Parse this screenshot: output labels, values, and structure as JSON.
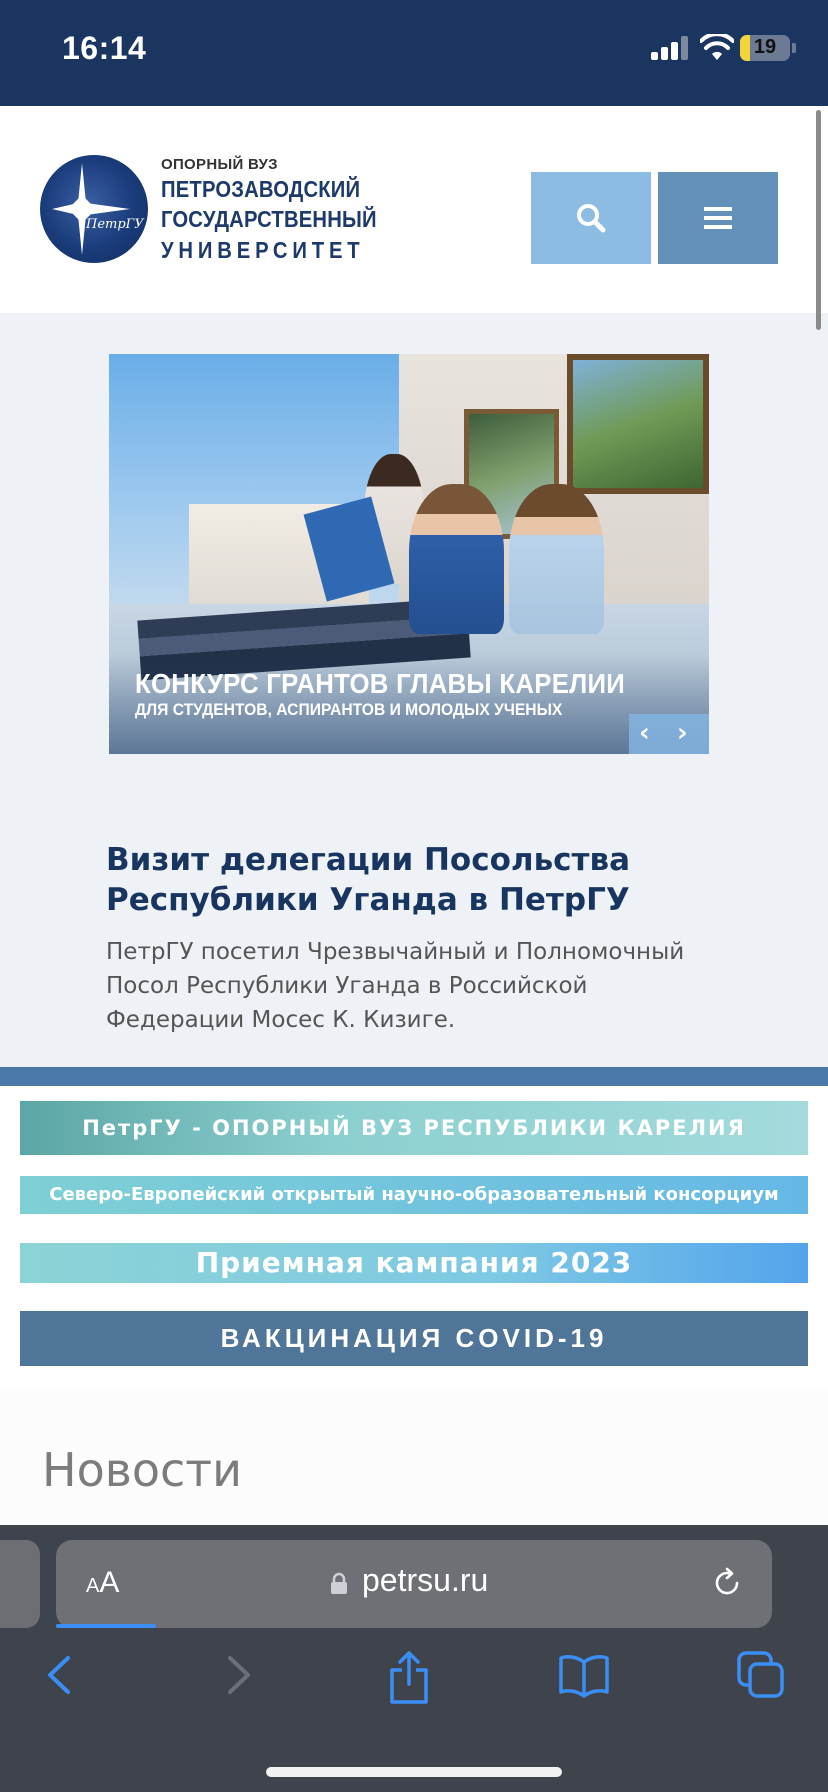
{
  "status_bar": {
    "time": "16:14",
    "battery_percent": "19"
  },
  "header": {
    "brand_top": "ОПОРНЫЙ ВУЗ",
    "brand_lines": [
      "ПЕТРОЗАВОДСКИЙ",
      "ГОСУДАРСТВЕННЫЙ",
      "УНИВЕРСИТЕТ"
    ],
    "logo_script": "ПетрГУ",
    "search_icon": "search-icon",
    "menu_icon": "hamburger-menu-icon"
  },
  "slider": {
    "title": "КОНКУРС ГРАНТОВ ГЛАВЫ КАРЕЛИИ",
    "subtitle": "ДЛЯ СТУДЕНТОВ, АСПИРАНТОВ И МОЛОДЫХ УЧЕНЫХ",
    "prev_glyph": "‹",
    "next_glyph": "›"
  },
  "featured_news": {
    "title": "Визит делегации Посольства Республики Уганда в ПетрГУ",
    "description": "ПетрГУ посетил Чрезвычайный и Полномочный Посол Республики Уганда в Российской Федерации Мосес К. Кизиге."
  },
  "banners": [
    "ПетрГУ - ОПОРНЫЙ ВУЗ РЕСПУБЛИКИ КАРЕЛИЯ",
    "Северо-Европейский открытый научно-образовательный консорциум",
    "Приемная кампания 2023",
    "ВАКЦИНАЦИЯ COVID-19"
  ],
  "news_section": {
    "heading": "Новости"
  },
  "browser": {
    "aa_small": "A",
    "aa_big": "A",
    "url": "petrsu.ru",
    "load_progress": 0.14,
    "accent_color": "#3a8ef5"
  }
}
